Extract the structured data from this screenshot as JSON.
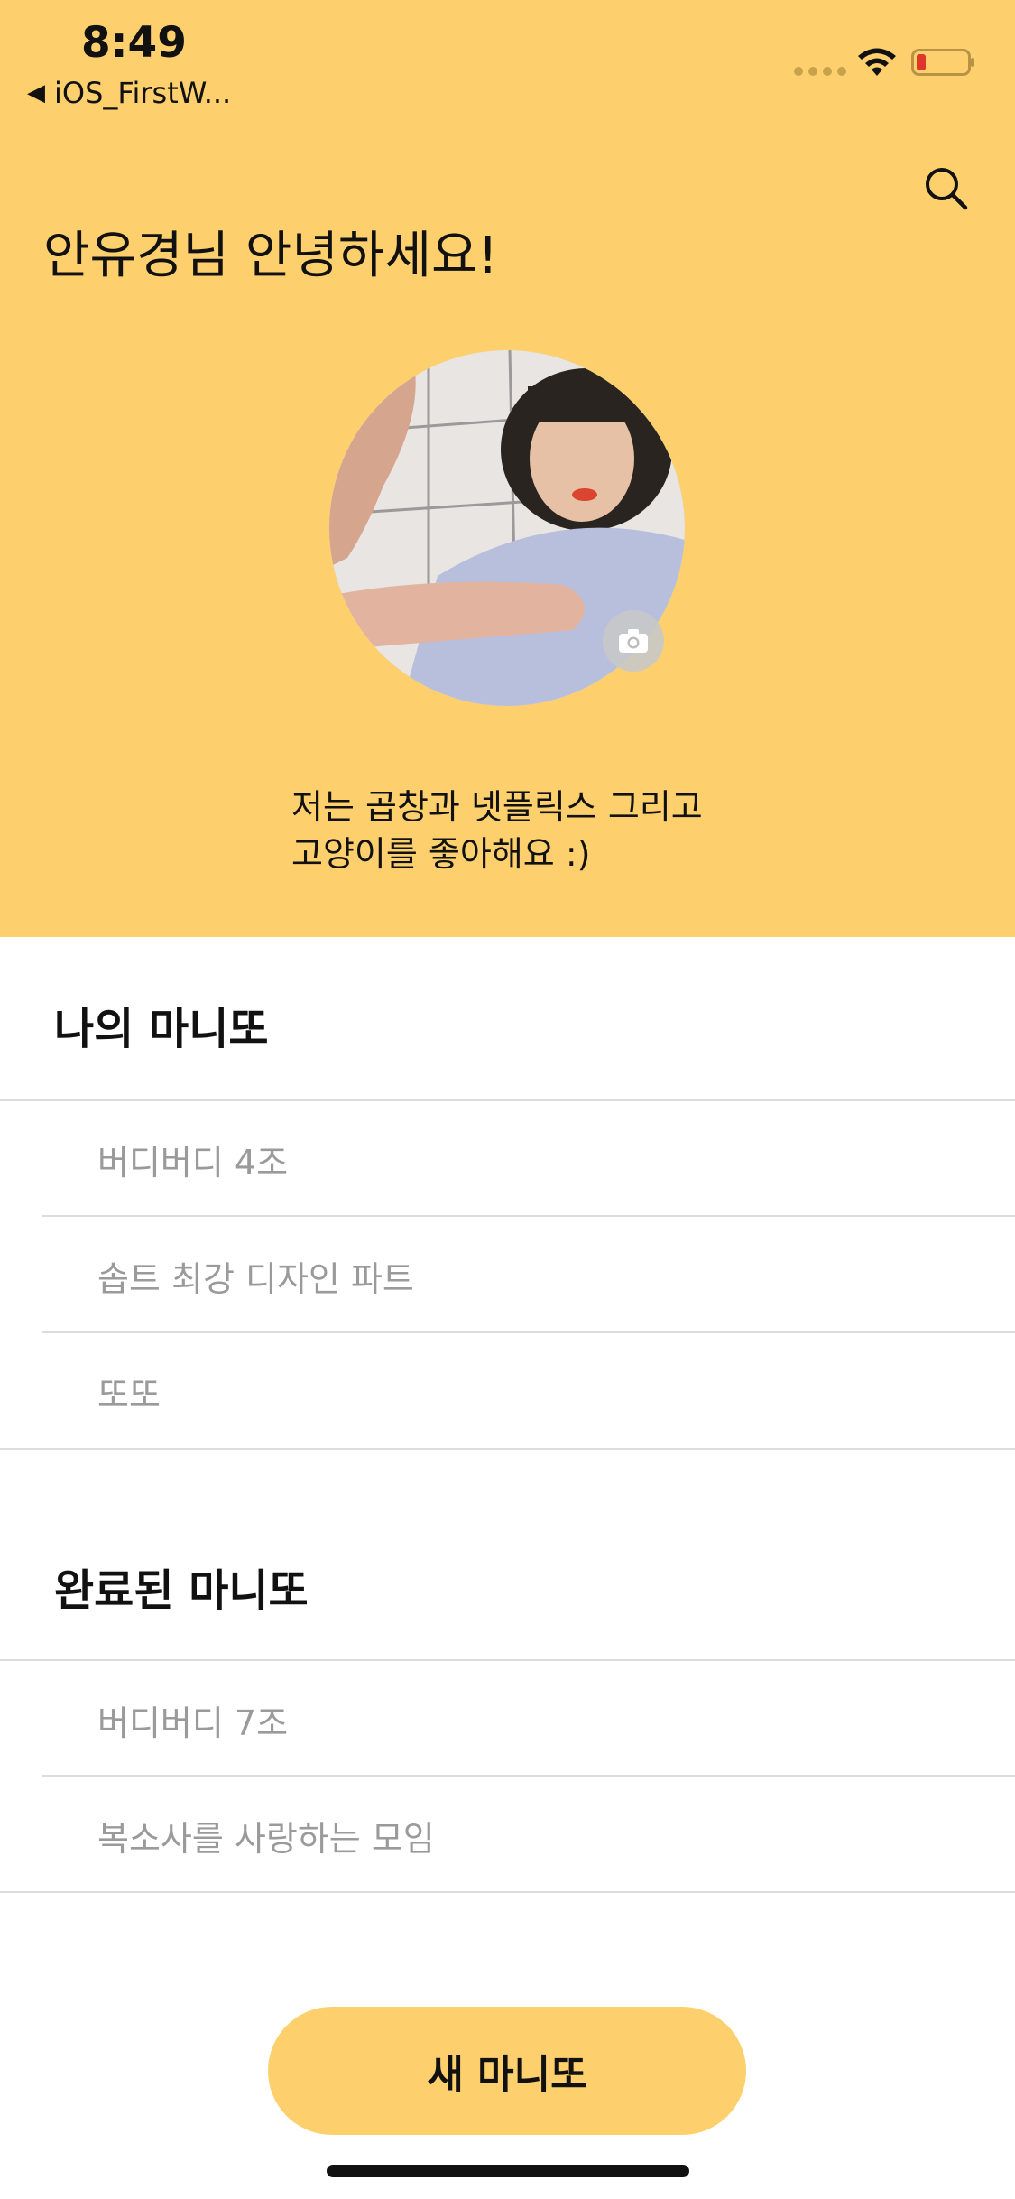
{
  "status_bar": {
    "time": "8:49",
    "back_app_label": "iOS_FirstW...",
    "signal_icon": "signal-dots-icon",
    "wifi_icon": "wifi-icon",
    "battery_icon": "battery-low-icon"
  },
  "header": {
    "greeting": "안유경님 안녕하세요!",
    "search_icon": "search-icon",
    "bio_line1": "저는 곱창과 넷플릭스 그리고",
    "bio_line2": "고양이를 좋아해요 :)",
    "background_color": "#FDD06D"
  },
  "my_manitto": {
    "title": "나의 마니또",
    "items": [
      {
        "label": "버디버디 4조"
      },
      {
        "label": "솝트 최강 디자인 파트"
      },
      {
        "label": "또또"
      }
    ]
  },
  "completed_manitto": {
    "title": "완료된 마니또",
    "items": [
      {
        "label": "버디버디 7조"
      },
      {
        "label": "복소사를 사랑하는 모임"
      }
    ]
  },
  "new_button": {
    "label": "새 마니또"
  }
}
